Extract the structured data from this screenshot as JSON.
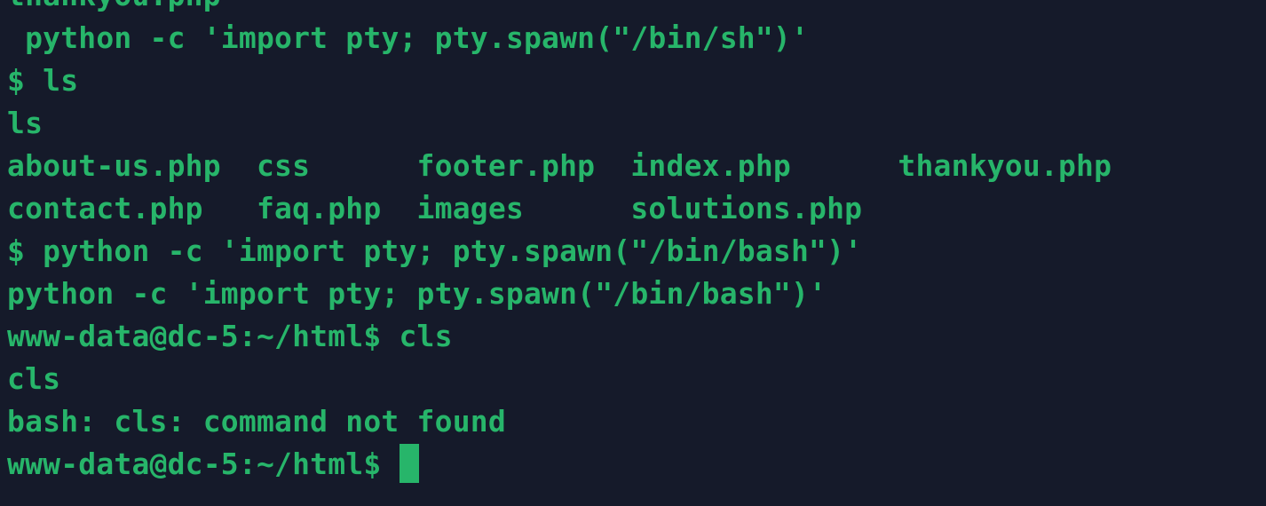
{
  "terminal": {
    "lines": [
      "thankyou.php",
      " python -c 'import pty; pty.spawn(\"/bin/sh\")'",
      "$ ls",
      "ls",
      "about-us.php  css      footer.php  index.php      thankyou.php",
      "contact.php   faq.php  images      solutions.php",
      "$ python -c 'import pty; pty.spawn(\"/bin/bash\")'",
      "python -c 'import pty; pty.spawn(\"/bin/bash\")'",
      "www-data@dc-5:~/html$ cls",
      "cls",
      "bash: cls: command not found"
    ],
    "prompt": "www-data@dc-5:~/html$ "
  },
  "colors": {
    "background": "#151a2a",
    "text": "#27b56a",
    "cursor": "#27b56a"
  }
}
